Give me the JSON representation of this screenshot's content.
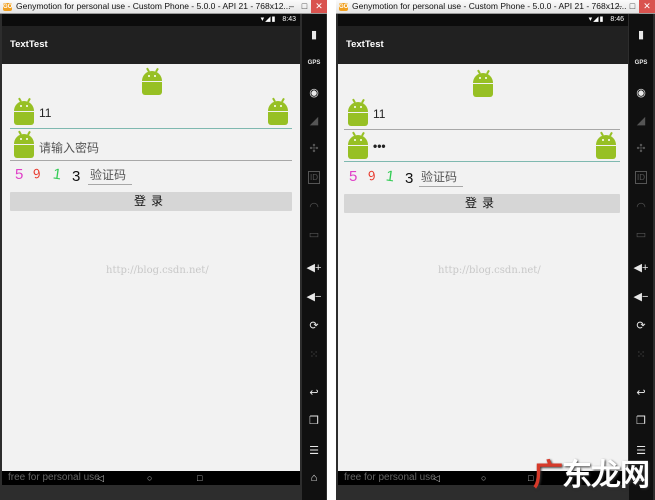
{
  "window": {
    "title_left": "Genymotion for personal use - Custom Phone - 5.0.0 - API 21 - 768x12...",
    "title_right": "Genymotion for personal use - Custom Phone - 5.0.0 - API 21 - 768x12...",
    "logo": "GO"
  },
  "status": {
    "time_left": "8:43",
    "time_right": "8:46"
  },
  "app": {
    "title": "TextTest"
  },
  "left": {
    "username": "11",
    "password_placeholder": "请输入密码",
    "captcha_digits": [
      "5",
      "9",
      "1",
      "3"
    ],
    "captcha_placeholder": "验证码",
    "login_label": "登录"
  },
  "right": {
    "username": "11",
    "password_value": "•••",
    "captcha_digits": [
      "5",
      "9",
      "1",
      "3"
    ],
    "captcha_placeholder": "验证码",
    "login_label": "登录"
  },
  "colors": {
    "captcha": [
      "#e040c8",
      "#e8392c",
      "#33cc55",
      "#111111"
    ],
    "android_green": "#97c024",
    "underline_active": "#7fb9b0"
  },
  "watermark": "http://blog.csdn.net/",
  "footer": {
    "free_text": "free for personal use"
  },
  "site_mark": {
    "part1": "广",
    "part2": "东龙网"
  },
  "sidebar_icons": [
    "battery-icon",
    "gps-icon",
    "camera-icon",
    "signal-icon",
    "dpad-icon",
    "id-icon",
    "rss-icon",
    "sms-icon",
    "volume-up-icon",
    "volume-down-icon",
    "rotate-icon",
    "pinch-icon",
    "back-icon",
    "recent-apps-icon",
    "menu-icon",
    "home-icon"
  ]
}
